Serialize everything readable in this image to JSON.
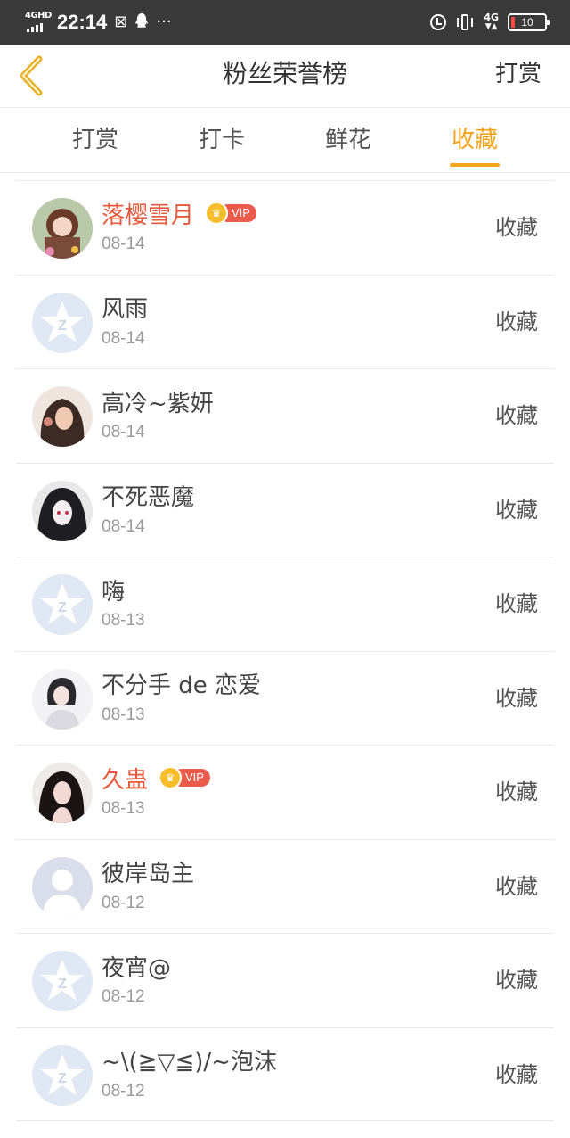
{
  "status_bar": {
    "network_label": "4GHD",
    "time": "22:14",
    "notif_icons": [
      "sim-icon",
      "qq-icon",
      "more-dots-icon"
    ],
    "more": "···",
    "network_right": "4G",
    "battery_level": "10",
    "battery_color": "#ff4b3e"
  },
  "header": {
    "title": "粉丝荣誉榜",
    "action_label": "打赏"
  },
  "tabs": [
    {
      "label": "打赏",
      "active": false
    },
    {
      "label": "打卡",
      "active": false
    },
    {
      "label": "鲜花",
      "active": false
    },
    {
      "label": "收藏",
      "active": true
    }
  ],
  "accent_color": "#f4a31b",
  "vip_label": "VIP",
  "fans": [
    {
      "name": "落樱雪月",
      "date": "08-14",
      "vip": true,
      "action": "收藏",
      "avatar": "anime-girl-avatar"
    },
    {
      "name": "风雨",
      "date": "08-14",
      "vip": false,
      "action": "收藏",
      "avatar": "default-star-avatar"
    },
    {
      "name": "高冷~紫妍",
      "date": "08-14",
      "vip": false,
      "action": "收藏",
      "avatar": "girl-photo-avatar"
    },
    {
      "name": "不死恶魔",
      "date": "08-14",
      "vip": false,
      "action": "收藏",
      "avatar": "dark-anime-avatar"
    },
    {
      "name": "嗨",
      "date": "08-13",
      "vip": false,
      "action": "收藏",
      "avatar": "default-star-avatar"
    },
    {
      "name": "不分手 de 恋爱",
      "date": "08-13",
      "vip": false,
      "action": "收藏",
      "avatar": "girl-photo-avatar"
    },
    {
      "name": "久蛊",
      "date": "08-13",
      "vip": true,
      "action": "收藏",
      "avatar": "girl-photo-avatar"
    },
    {
      "name": "彼岸岛主",
      "date": "08-12",
      "vip": false,
      "action": "收藏",
      "avatar": "default-person-avatar"
    },
    {
      "name": "夜宵@",
      "date": "08-12",
      "vip": false,
      "action": "收藏",
      "avatar": "default-star-avatar"
    },
    {
      "name": "~\\(≧▽≦)/~泡沫",
      "date": "08-12",
      "vip": false,
      "action": "收藏",
      "avatar": "default-star-avatar"
    }
  ]
}
